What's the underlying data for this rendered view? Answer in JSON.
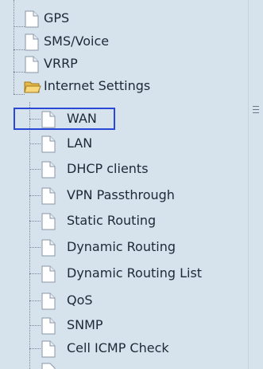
{
  "tree": {
    "items": [
      {
        "label": "GPS",
        "icon": "document-icon"
      },
      {
        "label": "SMS/Voice",
        "icon": "document-icon"
      },
      {
        "label": "VRRP",
        "icon": "document-icon"
      },
      {
        "label": "Internet Settings",
        "icon": "folder-open-icon"
      },
      {
        "label": "WAN",
        "icon": "document-icon",
        "selected": true
      },
      {
        "label": "LAN",
        "icon": "document-icon"
      },
      {
        "label": "DHCP clients",
        "icon": "document-icon"
      },
      {
        "label": "VPN Passthrough",
        "icon": "document-icon"
      },
      {
        "label": "Static Routing",
        "icon": "document-icon"
      },
      {
        "label": "Dynamic Routing",
        "icon": "document-icon"
      },
      {
        "label": "Dynamic Routing List",
        "icon": "document-icon"
      },
      {
        "label": "QoS",
        "icon": "document-icon"
      },
      {
        "label": "SNMP",
        "icon": "document-icon"
      },
      {
        "label": "Cell ICMP Check",
        "icon": "document-icon"
      }
    ]
  },
  "colors": {
    "background": "#d6e3ed",
    "selection_border": "#2a48d8",
    "text": "#1c2a36"
  }
}
